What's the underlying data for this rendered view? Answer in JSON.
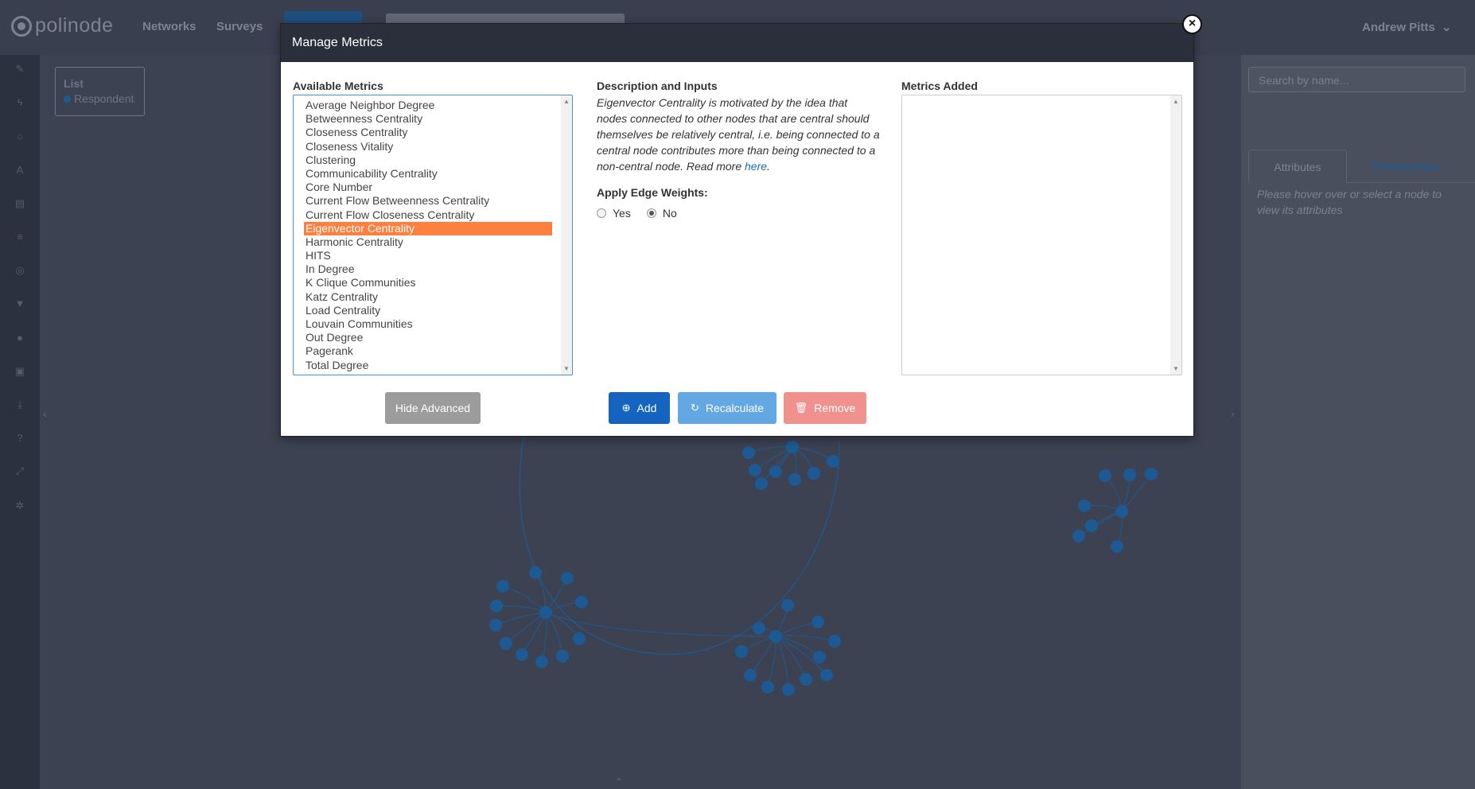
{
  "app": {
    "logo_text": "polinode",
    "nav": [
      "Networks",
      "Surveys"
    ],
    "user_name": "Andrew Pitts"
  },
  "legend": {
    "title": "List",
    "item": "Respondent"
  },
  "right_panel": {
    "search_placeholder": "Search by name...",
    "tabs": [
      "Attributes",
      "Relationships"
    ],
    "hint": "Please hover over or select a node to view its attributes"
  },
  "modal": {
    "title": "Manage Metrics",
    "available_title": "Available Metrics",
    "metrics": [
      "Average Neighbor Degree",
      "Betweenness Centrality",
      "Closeness Centrality",
      "Closeness Vitality",
      "Clustering",
      "Communicability Centrality",
      "Core Number",
      "Current Flow Betweenness Centrality",
      "Current Flow Closeness Centrality",
      "Eigenvector Centrality",
      "Harmonic Centrality",
      "HITS",
      "In Degree",
      "K Clique Communities",
      "Katz Centrality",
      "Load Centrality",
      "Louvain Communities",
      "Out Degree",
      "Pagerank",
      "Total Degree"
    ],
    "selected_metric": "Eigenvector Centrality",
    "description_title": "Description and Inputs",
    "description_text": "Eigenvector Centrality is motivated by the idea that nodes connected to other nodes that are central should themselves be relatively central, i.e. being connected to a central node contributes more than being connected to a non-central node. Read more ",
    "description_link": "here",
    "edge_weights_title": "Apply Edge Weights:",
    "edge_weight_options": [
      "Yes",
      "No"
    ],
    "edge_weight_selected": "No",
    "added_title": "Metrics Added",
    "buttons": {
      "hide_advanced": "Hide Advanced",
      "add": "Add",
      "recalculate": "Recalculate",
      "remove": "Remove"
    }
  },
  "colors": {
    "selected": "#ff7f3f",
    "primary": "#1565c0",
    "recalc": "#63a8e2",
    "remove": "#f0918d",
    "node": "#1d5a94"
  },
  "icons": [
    "pencil-icon",
    "bolt-icon",
    "circle-icon",
    "font-icon",
    "clipboard-icon",
    "list-icon",
    "target-icon",
    "filter-icon",
    "drop-icon",
    "camera-icon",
    "download-icon",
    "help-icon",
    "expand-icon",
    "gear-icon",
    "plus-circle-icon",
    "refresh-icon",
    "trash-icon",
    "close-icon"
  ]
}
